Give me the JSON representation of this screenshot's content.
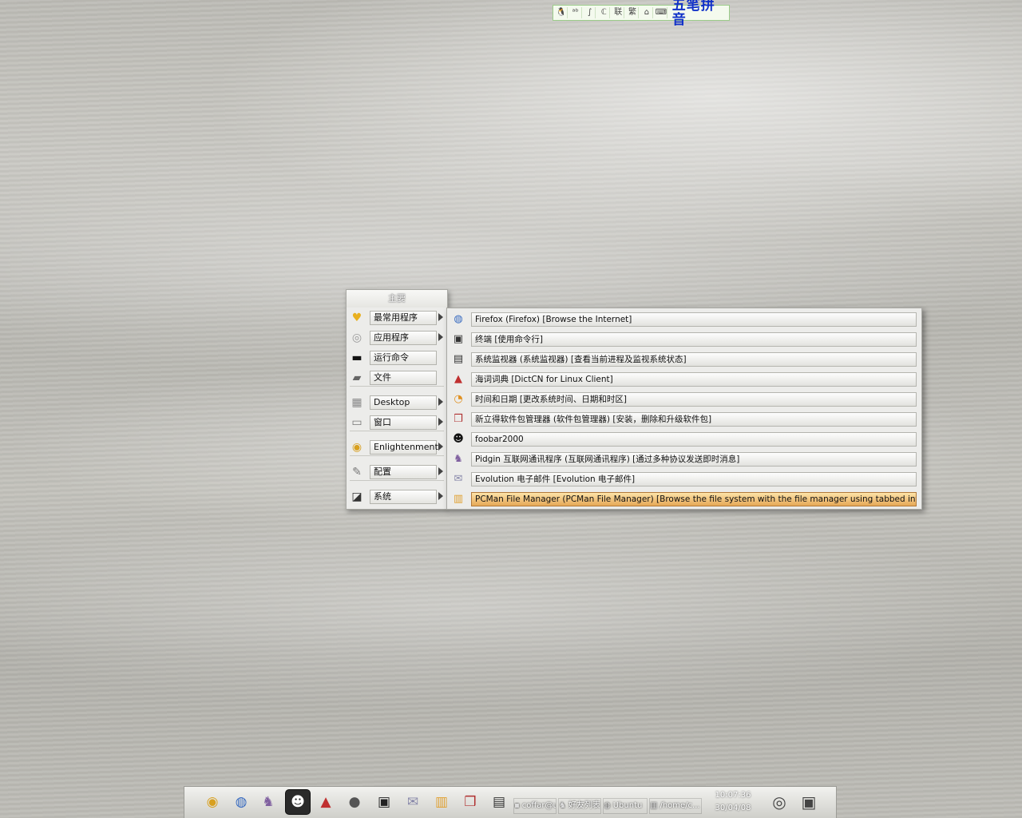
{
  "ime_bar": {
    "icons": [
      "tux-icon",
      "punctuation-icon",
      "pen-icon",
      "fullwidth-icon",
      "联",
      "繁",
      "lock-icon",
      "keyboard-icon"
    ],
    "icon_glyphs": [
      "🐧",
      "ᵃᵇ",
      "∫",
      "ℂ",
      "联",
      "繁",
      "⌂",
      "⌨"
    ],
    "input_method": "五笔拼音"
  },
  "main_menu": {
    "title": "主要",
    "items": [
      {
        "label": "最常用程序",
        "icon": "heart-icon",
        "glyph": "♥",
        "color": "#e8b020",
        "has_submenu": true
      },
      {
        "label": "应用程序",
        "icon": "cd-icon",
        "glyph": "◎",
        "color": "#999999",
        "has_submenu": true
      },
      {
        "label": "运行命令",
        "icon": "terminal-icon",
        "glyph": "▬",
        "color": "#111111",
        "has_submenu": false
      },
      {
        "label": "文件",
        "icon": "folder-icon",
        "glyph": "▰",
        "color": "#666666",
        "has_submenu": false
      },
      {
        "label": "Desktop",
        "icon": "desktop-grid-icon",
        "glyph": "▦",
        "color": "#888888",
        "has_submenu": true
      },
      {
        "label": "窗口",
        "icon": "window-icon",
        "glyph": "▭",
        "color": "#777777",
        "has_submenu": true
      },
      {
        "label": "Enlightenment",
        "icon": "enlightenment-icon",
        "glyph": "◉",
        "color": "#d8a020",
        "has_submenu": true
      },
      {
        "label": "配置",
        "icon": "wrench-icon",
        "glyph": "✎",
        "color": "#777777",
        "has_submenu": true
      },
      {
        "label": "系统",
        "icon": "laptop-icon",
        "glyph": "◪",
        "color": "#333333",
        "has_submenu": true
      }
    ]
  },
  "sub_menu": {
    "items": [
      {
        "label": "Firefox (Firefox) [Browse the Internet]",
        "icon": "globe-icon",
        "glyph": "◍",
        "color": "#3a6cc0"
      },
      {
        "label": "终端 [使用命令行]",
        "icon": "terminal-icon",
        "glyph": "▣",
        "color": "#333333"
      },
      {
        "label": "系统监视器 (系统监视器) [查看当前进程及监视系统状态]",
        "icon": "system-monitor-icon",
        "glyph": "▤",
        "color": "#333333"
      },
      {
        "label": "海词词典 [DictCN for Linux Client]",
        "icon": "dictionary-book-icon",
        "glyph": "▲",
        "color": "#c03030"
      },
      {
        "label": "时间和日期 [更改系统时间、日期和时区]",
        "icon": "clock-icon",
        "glyph": "◔",
        "color": "#e09020"
      },
      {
        "label": "新立得软件包管理器 (软件包管理器) [安装，删除和升级软件包]",
        "icon": "package-box-icon",
        "glyph": "❒",
        "color": "#b03030"
      },
      {
        "label": "foobar2000",
        "icon": "alien-icon",
        "glyph": "☻",
        "color": "#111111"
      },
      {
        "label": "Pidgin 互联网通讯程序 (互联网通讯程序) [通过多种协议发送即时消息]",
        "icon": "pidgin-bird-icon",
        "glyph": "♞",
        "color": "#8060a0"
      },
      {
        "label": "Evolution 电子邮件 [Evolution 电子邮件]",
        "icon": "mail-clock-icon",
        "glyph": "✉",
        "color": "#8888aa"
      },
      {
        "label": "PCMan File Manager (PCMan File Manager) [Browse the file system with the file manager using tabbed interface]",
        "icon": "file-cabinet-icon",
        "glyph": "▥",
        "color": "#e0a030",
        "selected": true
      }
    ]
  },
  "taskbar": {
    "launchers": [
      {
        "name": "enlightenment-launcher-icon",
        "glyph": "◉",
        "color": "#d8a020"
      },
      {
        "name": "firefox-launcher-icon",
        "glyph": "◍",
        "color": "#3a6cc0"
      },
      {
        "name": "pidgin-launcher-icon",
        "glyph": "♞",
        "color": "#8060a0"
      },
      {
        "name": "foobar-launcher-icon",
        "glyph": "☻",
        "color": "#ffffff",
        "active": true
      },
      {
        "name": "dictionary-launcher-icon",
        "glyph": "▲",
        "color": "#c03030"
      },
      {
        "name": "speaker-launcher-icon",
        "glyph": "●",
        "color": "#555555"
      },
      {
        "name": "terminal-launcher-icon",
        "glyph": "▣",
        "color": "#222222"
      },
      {
        "name": "mail-launcher-icon",
        "glyph": "✉",
        "color": "#8888aa"
      },
      {
        "name": "file-manager-launcher-icon",
        "glyph": "▥",
        "color": "#e0a030"
      },
      {
        "name": "package-manager-launcher-icon",
        "glyph": "❒",
        "color": "#b03030"
      },
      {
        "name": "system-monitor-launcher-icon",
        "glyph": "▤",
        "color": "#333333"
      }
    ],
    "tasks": [
      {
        "label": "coffar@u",
        "icon_glyph": "▪"
      },
      {
        "label": "好友列表",
        "icon_glyph": "♞"
      },
      {
        "label": "Ubuntu",
        "icon_glyph": "◍"
      },
      {
        "label": "/home/c...",
        "icon_glyph": "▥"
      }
    ],
    "clock": {
      "time": "10:07:36",
      "date": "30/04/08"
    },
    "tray": [
      {
        "name": "speaker-tray-icon",
        "glyph": "◎"
      },
      {
        "name": "camera-tray-icon",
        "glyph": "▣"
      }
    ]
  }
}
